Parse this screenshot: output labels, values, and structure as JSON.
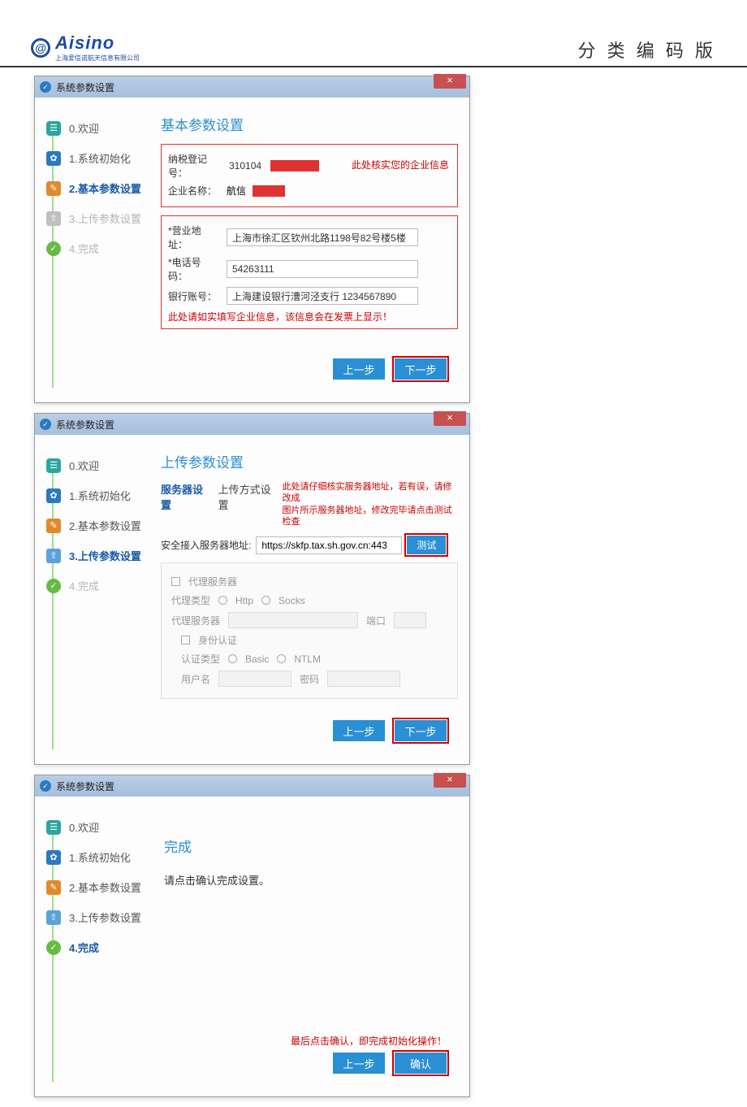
{
  "header": {
    "logo_name": "Aisino",
    "logo_sub": "上海爱信诺航天信息有限公司",
    "right": "分 类 编 码 版"
  },
  "dlg": {
    "title": "系统参数设置",
    "close": "×"
  },
  "steps": {
    "s0": "0.欢迎",
    "s1": "1.系统初始化",
    "s2": "2.基本参数设置",
    "s3": "3.上传参数设置",
    "s4": "4.完成"
  },
  "d1": {
    "title": "基本参数设置",
    "tax_lbl": "纳税登记号：",
    "tax_val": "310104",
    "co_lbl": "企业名称：",
    "co_val": "航信",
    "right_note": "此处核实您的企业信息",
    "addr_lbl": "*营业地址：",
    "addr_val": "上海市徐汇区钦州北路1198号82号楼5楼",
    "tel_lbl": "*电话号码：",
    "tel_val": "54263111",
    "bank_lbl": "银行账号：",
    "bank_val": "上海建设银行漕河泾支行 1234567890",
    "bottom_note": "此处请如实填写企业信息，该信息会在发票上显示！",
    "prev": "上一步",
    "next": "下一步"
  },
  "d2": {
    "title": "上传参数设置",
    "tab1": "服务器设置",
    "tab2": "上传方式设置",
    "warn1": "此处请仔细核实服务器地址，若有误，请修改成",
    "warn2": "图片所示服务器地址，修改完毕请点击测试检查",
    "srv_lbl": "安全接入服务器地址:",
    "srv_val": "https://skfp.tax.sh.gov.cn:443",
    "test": "测试",
    "proxy_chk": "代理服务器",
    "ptype_lbl": "代理类型",
    "http": "Http",
    "socks": "Socks",
    "psrv_lbl": "代理服务器",
    "port_lbl": "端口",
    "auth_chk": "身份认证",
    "atype_lbl": "认证类型",
    "basic": "Basic",
    "ntlm": "NTLM",
    "user_lbl": "用户名",
    "pwd_lbl": "密码",
    "prev": "上一步",
    "next": "下一步"
  },
  "d3": {
    "title": "完成",
    "msg": "请点击确认完成设置。",
    "note": "最后点击确认，即完成初始化操作！",
    "prev": "上一步",
    "confirm": "确认"
  }
}
